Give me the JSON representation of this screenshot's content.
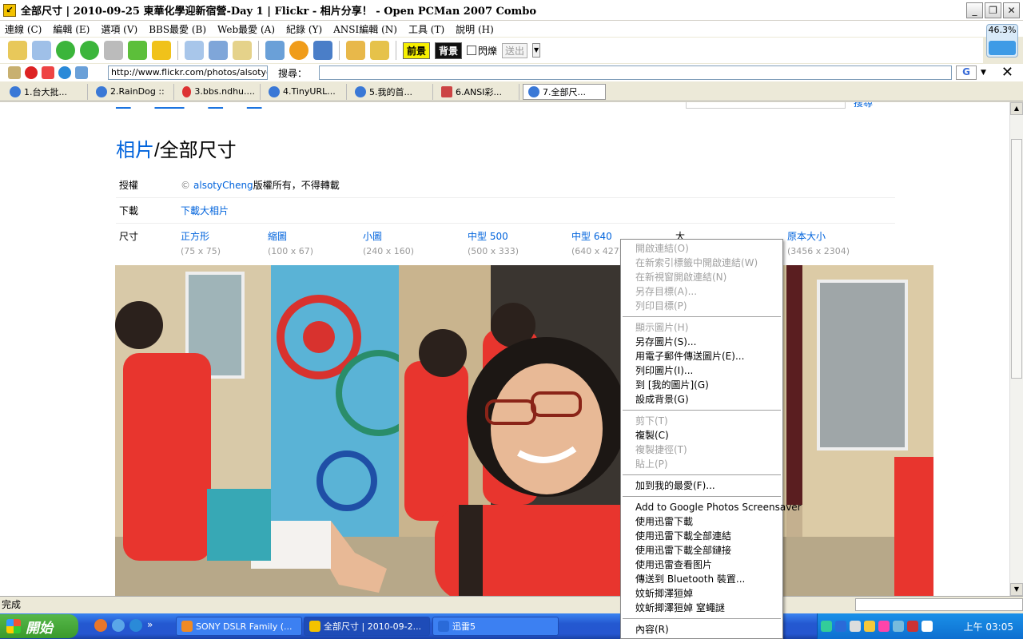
{
  "window": {
    "title": "全部尺寸 | 2010-09-25 東華化學迎新宿營-Day 1 | Flickr - 相片分享！ - Open PCMan 2007 Combo"
  },
  "menu": [
    "連線 (C)",
    "編輯 (E)",
    "選項 (V)",
    "BBS最愛 (B)",
    "Web最愛 (A)",
    "紀錄 (Y)",
    "ANSI編輯 (N)",
    "工具 (T)",
    "說明 (H)"
  ],
  "toolbar": {
    "front_label": "前景",
    "back_label": "背景",
    "blink_label": "閃爍",
    "send_label": "送出"
  },
  "net_meter": {
    "value": "46.3%"
  },
  "address": {
    "url": "http://www.flickr.com/photos/alsotych",
    "search_label": "搜尋：",
    "search_value": ""
  },
  "tabs": [
    {
      "label": "1.台大批..."
    },
    {
      "label": "2.RainDog ::"
    },
    {
      "label": "3.bbs.ndhu...."
    },
    {
      "label": "4.TinyURL..."
    },
    {
      "label": "5.我的首..."
    },
    {
      "label": "6.ANSI彩..."
    },
    {
      "label": "7.全部尺..."
    }
  ],
  "page": {
    "breadcrumb_link": "相片",
    "breadcrumb_current": "/全部尺寸",
    "license_key": "授權",
    "license_user": "alsotyCheng",
    "license_text": "版權所有，不得轉載",
    "download_key": "下載",
    "download_link": "下載大相片",
    "size_key": "尺寸",
    "sizes": [
      {
        "label": "正方形",
        "dim": "(75 x 75)"
      },
      {
        "label": "縮圖",
        "dim": "(100 x 67)"
      },
      {
        "label": "小圖",
        "dim": "(240 x 160)"
      },
      {
        "label": "中型 500",
        "dim": "(500 x 333)"
      },
      {
        "label": "中型 640",
        "dim": "(640 x 427)"
      },
      {
        "label": "大",
        "dim": ""
      },
      {
        "label": "原本大小",
        "dim": "(3456 x 2304)"
      }
    ],
    "top_search_btn": "搜尋"
  },
  "status": {
    "text": "完成"
  },
  "taskbar": {
    "start_label": "開始",
    "tasks": [
      {
        "label": "SONY DSLR Family (..."
      },
      {
        "label": "全部尺寸 | 2010-09-2..."
      },
      {
        "label": "迅雷5"
      }
    ],
    "clock": "上午 03:05"
  },
  "context_menu": {
    "groups": [
      [
        {
          "label": "開啟連結(O)",
          "enabled": false
        },
        {
          "label": "在新索引標籤中開啟連結(W)",
          "enabled": false
        },
        {
          "label": "在新視窗開啟連結(N)",
          "enabled": false
        },
        {
          "label": "另存目標(A)...",
          "enabled": false
        },
        {
          "label": "列印目標(P)",
          "enabled": false
        }
      ],
      [
        {
          "label": "顯示圖片(H)",
          "enabled": false
        },
        {
          "label": "另存圖片(S)...",
          "enabled": true
        },
        {
          "label": "用電子郵件傳送圖片(E)...",
          "enabled": true
        },
        {
          "label": "列印圖片(I)...",
          "enabled": true
        },
        {
          "label": "到 [我的圖片](G)",
          "enabled": true
        },
        {
          "label": "設成背景(G)",
          "enabled": true
        }
      ],
      [
        {
          "label": "剪下(T)",
          "enabled": false
        },
        {
          "label": "複製(C)",
          "enabled": true
        },
        {
          "label": "複製捷徑(T)",
          "enabled": false
        },
        {
          "label": "貼上(P)",
          "enabled": false
        }
      ],
      [
        {
          "label": "加到我的最愛(F)...",
          "enabled": true
        }
      ],
      [
        {
          "label": "Add to Google Photos Screensaver",
          "enabled": true
        },
        {
          "label": "使用迅雷下載",
          "enabled": true
        },
        {
          "label": "使用迅雷下載全部連結",
          "enabled": true
        },
        {
          "label": "使用迅雷下載全部鏈接",
          "enabled": true
        },
        {
          "label": "使用迅雷查看图片",
          "enabled": true
        },
        {
          "label": "傳送到 Bluetooth 裝置...",
          "enabled": true
        },
        {
          "label": "妏蚚揤澤狟婥",
          "enabled": true
        },
        {
          "label": "妏蚚揤澤狟婥    窒蠅謎",
          "enabled": true
        }
      ],
      [
        {
          "label": "內容(R)",
          "enabled": true
        }
      ]
    ]
  }
}
